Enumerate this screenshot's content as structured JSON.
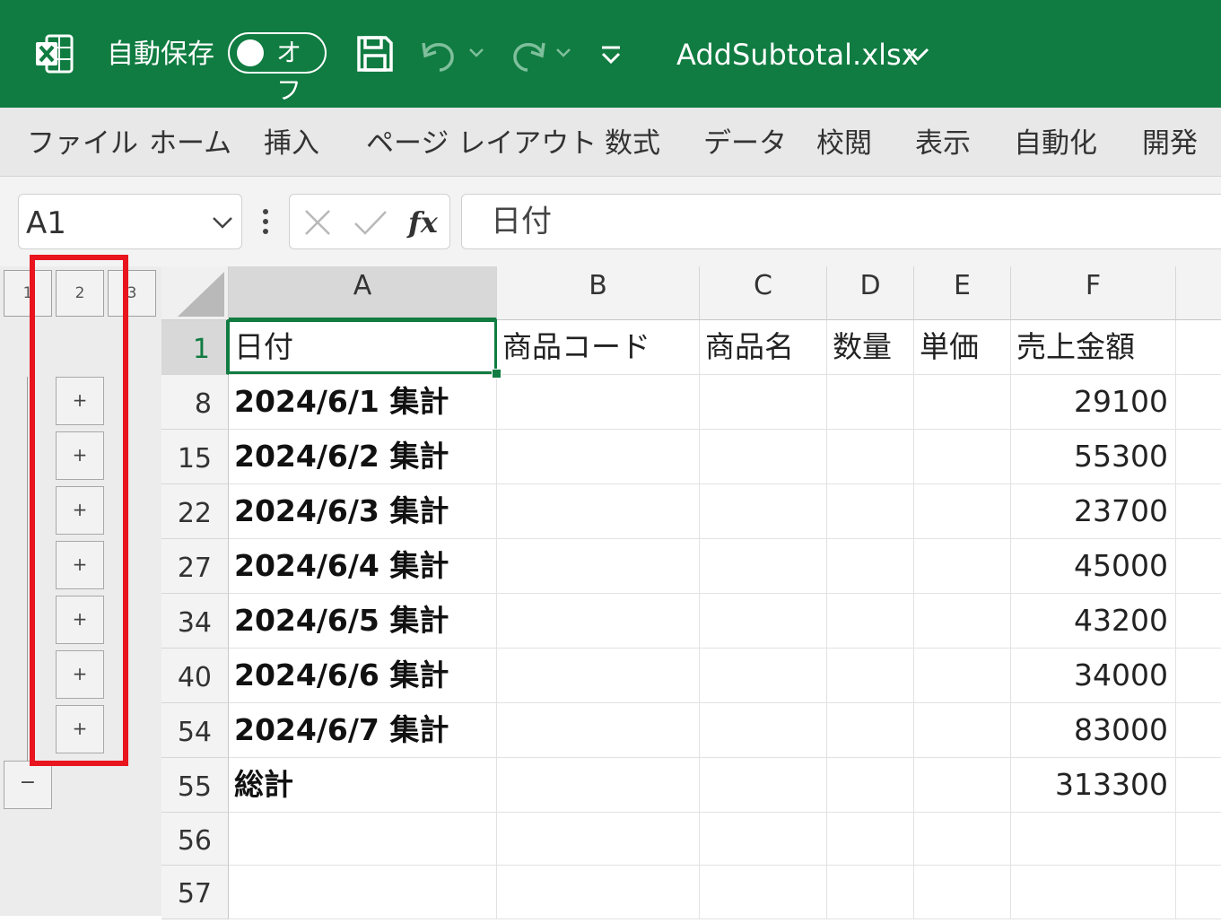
{
  "titlebar": {
    "autosave_label": "自動保存",
    "autosave_state": "オフ",
    "filename": "AddSubtotal.xlsx",
    "accent_color": "#107c41",
    "icons": [
      "excel-logo-icon",
      "save-icon",
      "undo-icon",
      "redo-icon",
      "customize-qat-icon",
      "chevron-down-icon"
    ]
  },
  "ribbon": {
    "tabs": [
      "ファイル",
      "ホーム",
      "挿入",
      "ページ レイアウト",
      "数式",
      "データ",
      "校閲",
      "表示",
      "自動化",
      "開発"
    ]
  },
  "formula_bar": {
    "name_box": "A1",
    "formula": "日付"
  },
  "outline": {
    "levels": [
      "1",
      "2",
      "3"
    ],
    "expand_symbol": "+",
    "collapse_symbol": "−",
    "highlight_color": "#e8141e"
  },
  "sheet": {
    "columns": [
      "A",
      "B",
      "C",
      "D",
      "E",
      "F"
    ],
    "selected_cell": "A1",
    "rows": [
      {
        "num": "1",
        "cells": [
          "日付",
          "商品コード",
          "商品名",
          "数量",
          "単価",
          "売上金額"
        ]
      },
      {
        "num": "8",
        "cells": [
          "2024/6/1 集計",
          "",
          "",
          "",
          "",
          "29100"
        ]
      },
      {
        "num": "15",
        "cells": [
          "2024/6/2 集計",
          "",
          "",
          "",
          "",
          "55300"
        ]
      },
      {
        "num": "22",
        "cells": [
          "2024/6/3 集計",
          "",
          "",
          "",
          "",
          "23700"
        ]
      },
      {
        "num": "27",
        "cells": [
          "2024/6/4 集計",
          "",
          "",
          "",
          "",
          "45000"
        ]
      },
      {
        "num": "34",
        "cells": [
          "2024/6/5 集計",
          "",
          "",
          "",
          "",
          "43200"
        ]
      },
      {
        "num": "40",
        "cells": [
          "2024/6/6 集計",
          "",
          "",
          "",
          "",
          "34000"
        ]
      },
      {
        "num": "54",
        "cells": [
          "2024/6/7 集計",
          "",
          "",
          "",
          "",
          "83000"
        ]
      },
      {
        "num": "55",
        "cells": [
          "総計",
          "",
          "",
          "",
          "",
          "313300"
        ]
      },
      {
        "num": "56",
        "cells": [
          "",
          "",
          "",
          "",
          "",
          ""
        ]
      },
      {
        "num": "57",
        "cells": [
          "",
          "",
          "",
          "",
          "",
          ""
        ]
      }
    ]
  }
}
